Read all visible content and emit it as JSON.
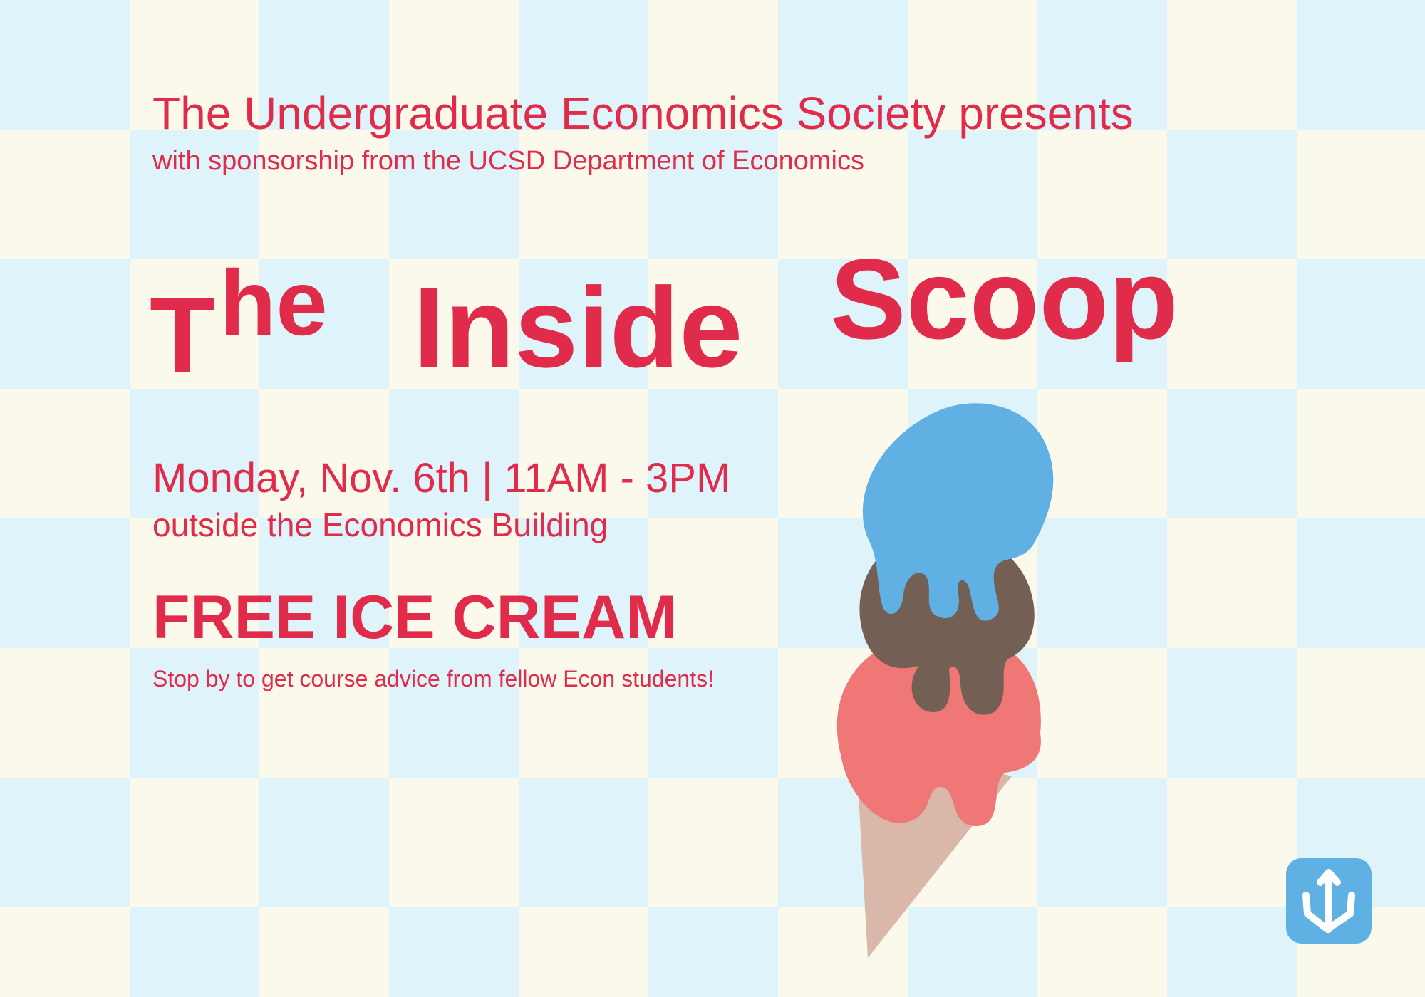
{
  "poster": {
    "presenter": "The Undergraduate Economics Society presents",
    "sponsor": "with sponsorship from the UCSD Department of Economics",
    "title": {
      "word1_first": "T",
      "word1_rest": "he",
      "word2": "Inside",
      "word3": "Scoop"
    },
    "datetime": "Monday, Nov. 6th | 11AM - 3PM",
    "location": "outside the Economics Building",
    "headline": "FREE ICE CREAM",
    "tagline": "Stop by to get course advice from fellow Econ students!"
  },
  "illustration": {
    "icon": "ice-cream-cone-icon",
    "scoop_colors": [
      "#60b0e3",
      "#745f55",
      "#ef7876"
    ],
    "cone_color": "#d9b8a9"
  },
  "logo": {
    "icon": "trident-icon",
    "color": "#5fb0e3"
  },
  "colors": {
    "text": "#e02b4a",
    "check_light": "#fbf9ec",
    "check_blue": "#def3fa"
  }
}
